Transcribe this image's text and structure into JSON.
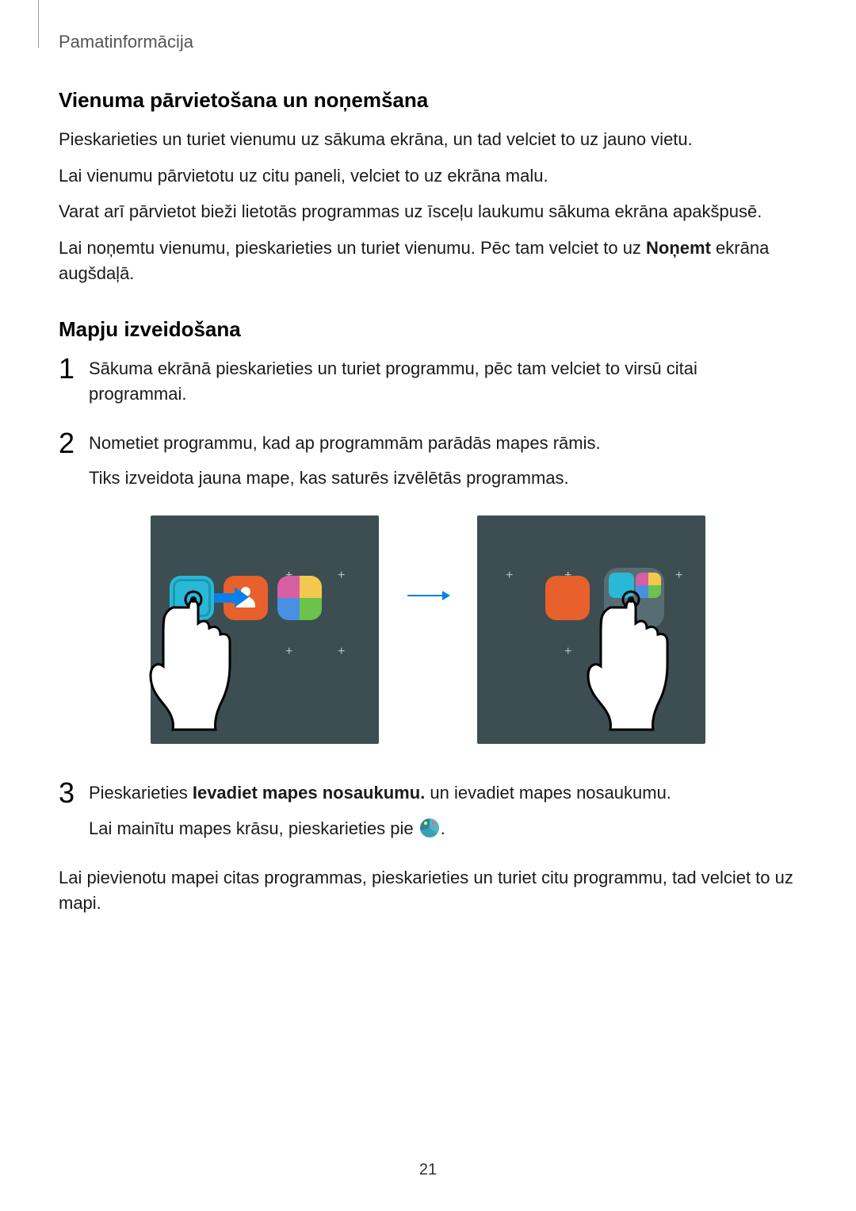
{
  "header": {
    "section_label": "Pamatinformācija"
  },
  "section1": {
    "title": "Vienuma pārvietošana un noņemšana",
    "p1": "Pieskarieties un turiet vienumu uz sākuma ekrāna, un tad velciet to uz jauno vietu.",
    "p2": "Lai vienumu pārvietotu uz citu paneli, velciet to uz ekrāna malu.",
    "p3": "Varat arī pārvietot bieži lietotās programmas uz īsceļu laukumu sākuma ekrāna apakšpusē.",
    "p4a": "Lai noņemtu vienumu, pieskarieties un turiet vienumu. Pēc tam velciet to uz ",
    "p4b": "Noņemt",
    "p4c": " ekrāna augšdaļā."
  },
  "section2": {
    "title": "Mapju izveidošana",
    "step1": "Sākuma ekrānā pieskarieties un turiet programmu, pēc tam velciet to virsū citai programmai.",
    "step2a": "Nometiet programmu, kad ap programmām parādās mapes rāmis.",
    "step2b": "Tiks izveidota jauna mape, kas saturēs izvēlētās programmas.",
    "step3a": "Pieskarieties ",
    "step3b": "Ievadiet mapes nosaukumu.",
    "step3c": " un ievadiet mapes nosaukumu.",
    "step3d": "Lai mainītu mapes krāsu, pieskarieties pie ",
    "step3e": ".",
    "closing": "Lai pievienotu mapei citas programmas, pieskarieties un turiet citu programmu, tad velciet to uz mapi."
  },
  "nums": {
    "n1": "1",
    "n2": "2",
    "n3": "3"
  },
  "page_number": "21"
}
